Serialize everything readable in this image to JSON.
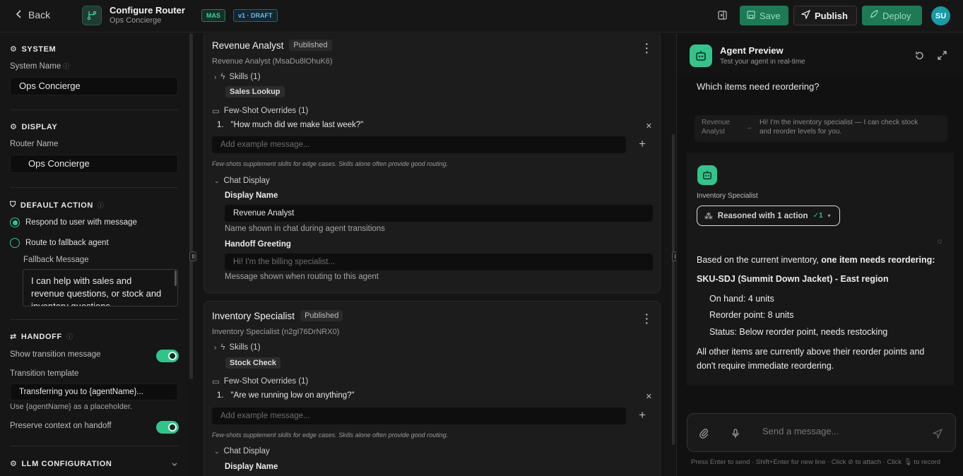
{
  "header": {
    "back_label": "Back",
    "title": "Configure Router",
    "subtitle": "Ops Concierge",
    "tag_mas": "MAS",
    "tag_version": "v1 · DRAFT",
    "save_label": "Save",
    "publish_label": "Publish",
    "deploy_label": "Deploy",
    "avatar_initials": "SU"
  },
  "sidebar": {
    "system": {
      "title": "SYSTEM",
      "name_label": "System Name",
      "name_value": "Ops Concierge"
    },
    "display": {
      "title": "DISPLAY",
      "router_label": "Router Name",
      "router_value": "Ops Concierge"
    },
    "default_action": {
      "title": "DEFAULT ACTION",
      "option_respond": "Respond to user with message",
      "option_route": "Route to fallback agent",
      "fallback_label": "Fallback Message",
      "fallback_value": "I can help with sales and revenue questions, or stock and inventory questions."
    },
    "handoff": {
      "title": "HANDOFF",
      "show_transition": "Show transition message",
      "template_label": "Transition template",
      "template_value": "Transferring you to {agentName}...",
      "placeholder_hint": "Use {agentName} as a placeholder.",
      "preserve_context": "Preserve context on handoff"
    },
    "llm": {
      "title": "LLM CONFIGURATION"
    }
  },
  "agents": [
    {
      "name": "Revenue Analyst",
      "status": "Published",
      "id_line": "Revenue Analyst (MsaDu8lOhuK6)",
      "skills_label": "Skills (1)",
      "skill": "Sales Lookup",
      "fewshot_label": "Few-Shot Overrides (1)",
      "example": "\"How much did we make last week?\"",
      "example_num": "1.",
      "add_placeholder": "Add example message...",
      "note": "Few-shots supplement skills for edge cases. Skills alone often provide good routing.",
      "chat_display": "Chat Display",
      "display_name_label": "Display Name",
      "display_name_value": "Revenue Analyst",
      "display_name_hint": "Name shown in chat during agent transitions",
      "greeting_label": "Handoff Greeting",
      "greeting_placeholder": "Hi! I'm the billing specialist...",
      "greeting_hint": "Message shown when routing to this agent"
    },
    {
      "name": "Inventory Specialist",
      "status": "Published",
      "id_line": "Inventory Specialist (n2gI76DrNRX0)",
      "skills_label": "Skills (1)",
      "skill": "Stock Check",
      "fewshot_label": "Few-Shot Overrides (1)",
      "example": "\"Are we running low on anything?\"",
      "example_num": "1.",
      "add_placeholder": "Add example message...",
      "note": "Few-shots supplement skills for edge cases. Skills alone often provide good routing.",
      "chat_display": "Chat Display",
      "display_name_label": "Display Name"
    }
  ],
  "preview": {
    "title": "Agent Preview",
    "subtitle": "Test your agent in real-time",
    "user_message": "Which items need reordering?",
    "transition_from_1": "Revenue",
    "transition_from_2": "Analyst",
    "transition_text_1": "Hi! I'm the inventory specialist — I can check stock",
    "transition_text_2": "and reorder levels for you.",
    "agent_name": "Inventory Specialist",
    "reasoned": "Reasoned with 1 action",
    "check": "✓1",
    "answer_intro": "Based on the current inventory, ",
    "answer_bold": "one item needs reordering:",
    "sku_line": "SKU-SDJ (Summit Down Jacket) - East region",
    "bullet_1": "On hand: 4 units",
    "bullet_2": "Reorder point: 8 units",
    "bullet_3": "Status: Below reorder point, needs restocking",
    "closing_1": "All other items are currently above their reorder points and",
    "closing_2": "don't require immediate reordering.",
    "input_placeholder": "Send a message...",
    "footer_hint": "Press Enter to send · Shift+Enter for new line · Click ⊘ to attach · Click 🎙 to record"
  },
  "colors": {
    "accent": "#2fc48a",
    "save_bg": "#1d7a55",
    "background": "#151515"
  }
}
